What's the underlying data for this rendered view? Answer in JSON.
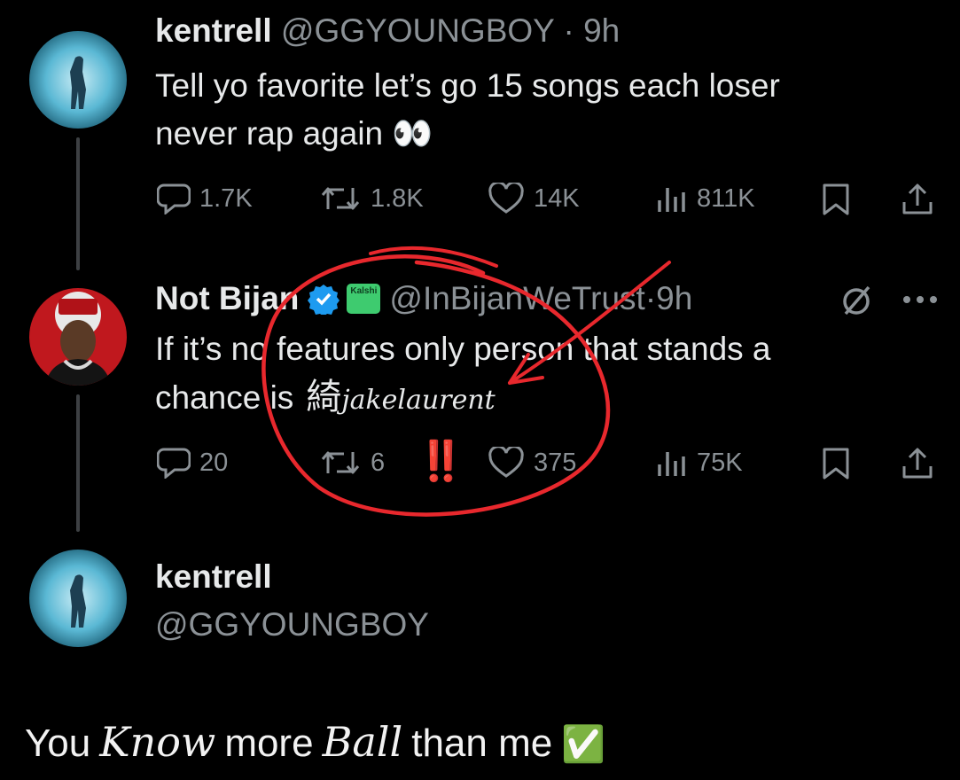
{
  "tweet1": {
    "name": "kentrell",
    "handle": "@GGYOUNGBOY",
    "time": "9h",
    "text_line1": "Tell yo favorite let’s go 15 songs each loser",
    "text_line2": "never rap again",
    "emoji": "👀",
    "replies": "1.7K",
    "reposts": "1.8K",
    "likes": "14K",
    "views": "811K"
  },
  "tweet2": {
    "name": "Not Bijan",
    "badge_label": "Kalshi",
    "handle": "@InBijanWeTrust",
    "time": "9h",
    "text_line1": "If it’s no features only person that stands a",
    "text_line2": "chance is",
    "replies": "20",
    "reposts": "6",
    "likes": "375",
    "views": "75K"
  },
  "annotation": {
    "exclamation": "‼️",
    "watermark_glyph": "綺",
    "watermark_text": "jakelaurent",
    "stroke_color": "#e8282d"
  },
  "tweet3": {
    "name": "kentrell",
    "handle": "@GGYOUNGBOY"
  },
  "caption": {
    "word1": "You",
    "word2": "Know",
    "word3": "more",
    "word4": "Ball",
    "word5": "than me",
    "emoji": "✅"
  },
  "colors": {
    "background": "#000000",
    "text": "#e7e9ea",
    "secondary": "#8b9196",
    "verified": "#1d9bf0",
    "kalshi_badge": "#3ecb6f"
  },
  "icons": [
    "reply-icon",
    "repost-icon",
    "like-icon",
    "views-icon",
    "bookmark-icon",
    "share-icon",
    "verified-icon",
    "grok-icon",
    "more-icon"
  ]
}
